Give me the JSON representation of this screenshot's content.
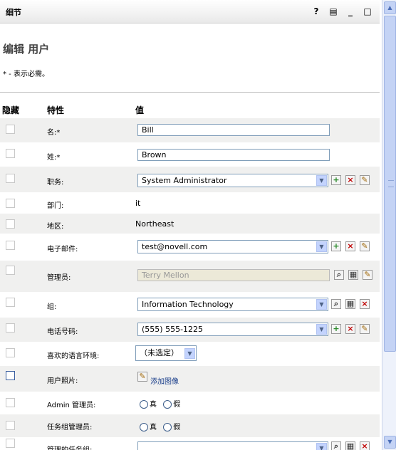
{
  "titlebar": {
    "title": "细节",
    "help": "?",
    "print": "▤",
    "minimize": "_",
    "maximize": "□"
  },
  "page": {
    "heading": "编辑 用户",
    "required_note": "* - 表示必需。"
  },
  "columns": {
    "hide": "隐藏",
    "attribute": "特性",
    "value": "值"
  },
  "rows": {
    "first_name": {
      "label": "名:*",
      "value": "Bill"
    },
    "last_name": {
      "label": "姓:*",
      "value": "Brown"
    },
    "title": {
      "label": "职务:",
      "value": "System Administrator"
    },
    "department": {
      "label": "部门:",
      "value": "it"
    },
    "region": {
      "label": "地区:",
      "value": "Northeast"
    },
    "email": {
      "label": "电子邮件:",
      "value": "test@novell.com"
    },
    "manager": {
      "label": "管理员:",
      "value": "Terry Mellon"
    },
    "group": {
      "label": "组:",
      "value": "Information Technology"
    },
    "phone": {
      "label": "电话号码:",
      "value": "(555) 555-1225"
    },
    "locale": {
      "label": "喜欢的语言环境:",
      "value": "（未选定）"
    },
    "photo": {
      "label": "用户照片:",
      "value": "添加图像"
    },
    "admin_manager": {
      "label": "Admin 管理员:",
      "true_label": "真",
      "false_label": "假"
    },
    "task_group_manager": {
      "label": "任务组管理员:",
      "true_label": "真",
      "false_label": "假"
    },
    "managed_task_groups": {
      "label": "管理的任务组:"
    }
  }
}
